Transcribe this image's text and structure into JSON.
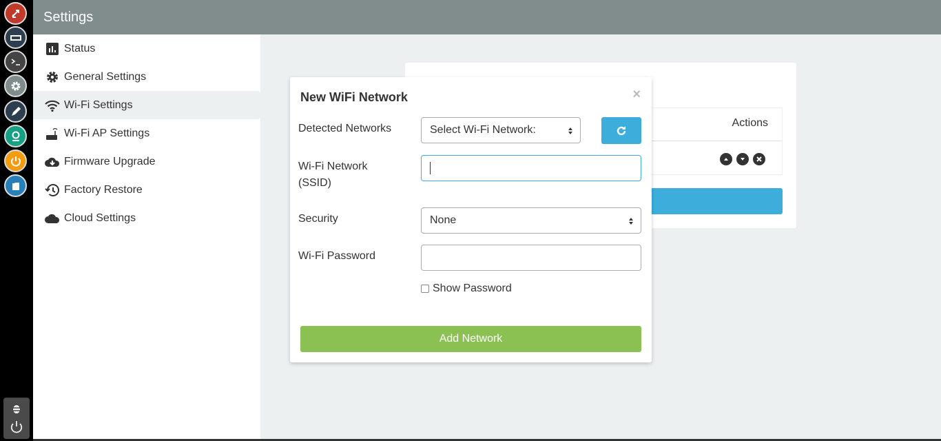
{
  "header": {
    "title": "Settings"
  },
  "dock": {
    "apps": [
      {
        "icon": "transfer-icon",
        "color": "#c0392b"
      },
      {
        "icon": "window-icon",
        "color": "#2c3e50"
      },
      {
        "icon": "terminal-icon",
        "color": "#444444"
      },
      {
        "icon": "gear-icon",
        "color": "#7f8c8d"
      },
      {
        "icon": "pencil-icon",
        "color": "#2c3e50"
      },
      {
        "icon": "webcam-icon",
        "color": "#16a085"
      },
      {
        "icon": "power-icon",
        "color": "#f39c12"
      },
      {
        "icon": "folder-icon",
        "color": "#2980b9"
      }
    ],
    "bottom": [
      "bug-icon",
      "power-icon"
    ]
  },
  "sidebar": {
    "items": [
      {
        "label": "Status",
        "icon": "bar-chart-icon"
      },
      {
        "label": "General Settings",
        "icon": "gear-icon"
      },
      {
        "label": "Wi-Fi Settings",
        "icon": "wifi-icon",
        "active": true
      },
      {
        "label": "Wi-Fi AP Settings",
        "icon": "router-icon"
      },
      {
        "label": "Firmware Upgrade",
        "icon": "cloud-download-icon"
      },
      {
        "label": "Factory Restore",
        "icon": "history-icon"
      },
      {
        "label": "Cloud Settings",
        "icon": "cloud-icon"
      }
    ]
  },
  "background_card": {
    "actions_header": "Actions"
  },
  "modal": {
    "title": "New WiFi Network",
    "close": "×",
    "detected_label": "Detected Networks",
    "detected_value": "Select Wi-Fi Network:",
    "ssid_label": "Wi-Fi Network (SSID)",
    "ssid_value": "",
    "security_label": "Security",
    "security_value": "None",
    "password_label": "Wi-Fi Password",
    "password_value": "",
    "show_password": "Show Password",
    "show_password_checked": false,
    "add_button": "Add Network"
  },
  "colors": {
    "header": "#818c8c",
    "accent": "#3daedb",
    "success": "#8bc152"
  }
}
